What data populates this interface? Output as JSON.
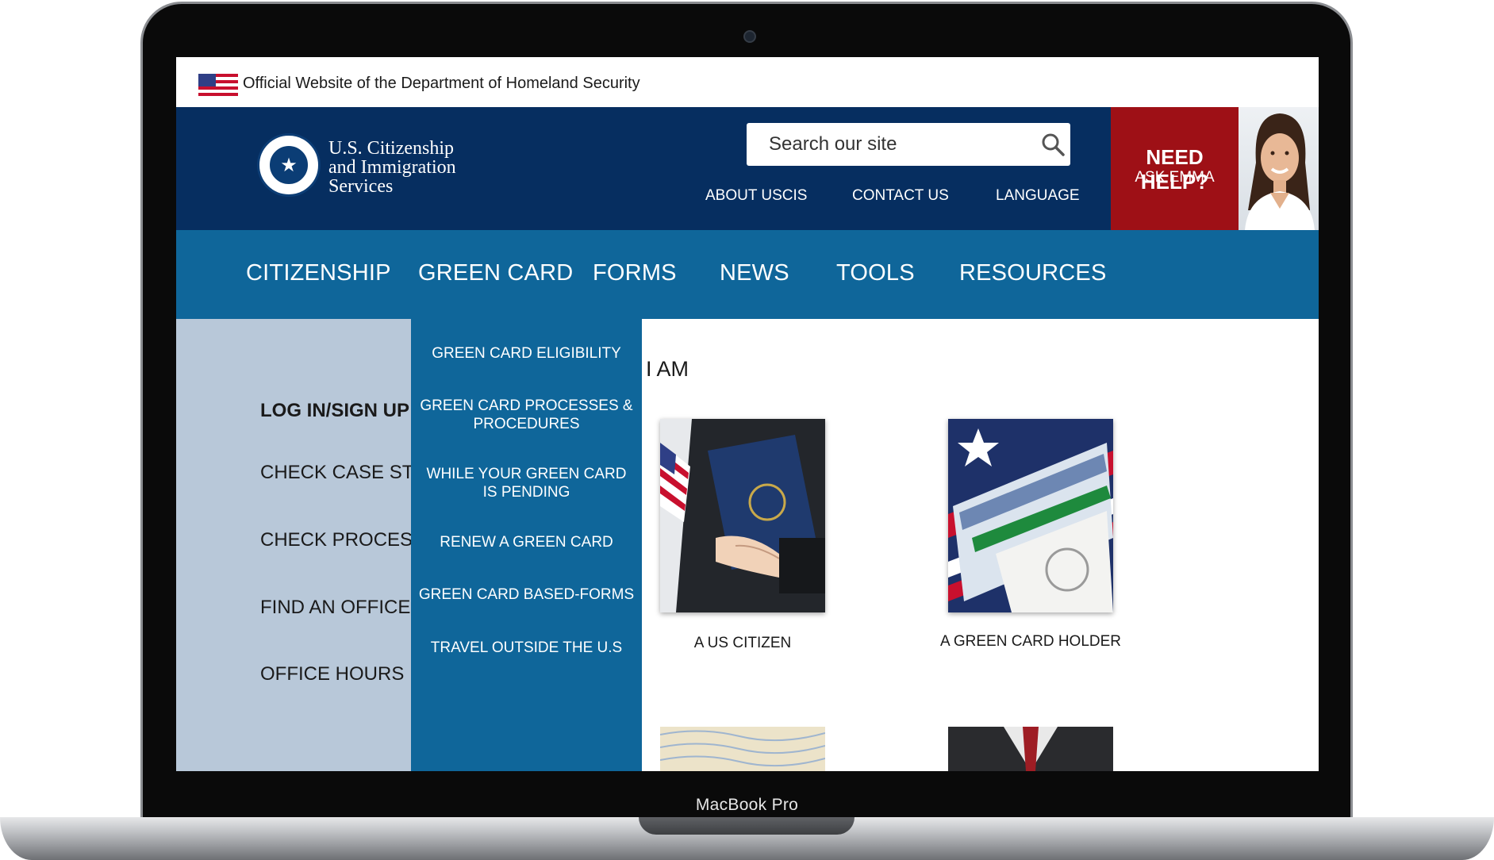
{
  "device": {
    "label": "MacBook Pro"
  },
  "banner": {
    "text": "Official Website of the Department of Homeland Security"
  },
  "header": {
    "logo_text": "U.S. Citizenship\nand Immigration\nServices",
    "search": {
      "placeholder": "Search our site"
    },
    "links": [
      "ABOUT USCIS",
      "CONTACT US",
      "LANGUAGE"
    ],
    "help": {
      "title": "NEED HELP?",
      "subtitle": "ASK EMMA"
    }
  },
  "nav": {
    "items": [
      "CITIZENSHIP",
      "GREEN CARD",
      "FORMS",
      "NEWS",
      "TOOLS",
      "RESOURCES"
    ]
  },
  "dropdown": {
    "items": [
      "GREEN CARD ELIGIBILITY",
      "GREEN CARD PROCESSES &\nPROCEDURES",
      "WHILE YOUR GREEN CARD\nIS PENDING",
      "RENEW A GREEN CARD",
      "GREEN CARD BASED-FORMS",
      "TRAVEL OUTSIDE THE U.S"
    ]
  },
  "sidebar": {
    "items": [
      "LOG IN/SIGN UP",
      "CHECK CASE STATUS",
      "CHECK PROCESSING TIMES",
      "FIND AN OFFICE",
      "OFFICE HOURS"
    ]
  },
  "main": {
    "heading": "I AM",
    "cards": [
      {
        "label": "A US CITIZEN"
      },
      {
        "label": "A GREEN CARD HOLDER"
      }
    ]
  },
  "colors": {
    "header_bg": "#062e60",
    "nav_bg": "#0f669a",
    "help_bg": "#9e1016",
    "sidebar_bg": "#b8c8d9"
  }
}
